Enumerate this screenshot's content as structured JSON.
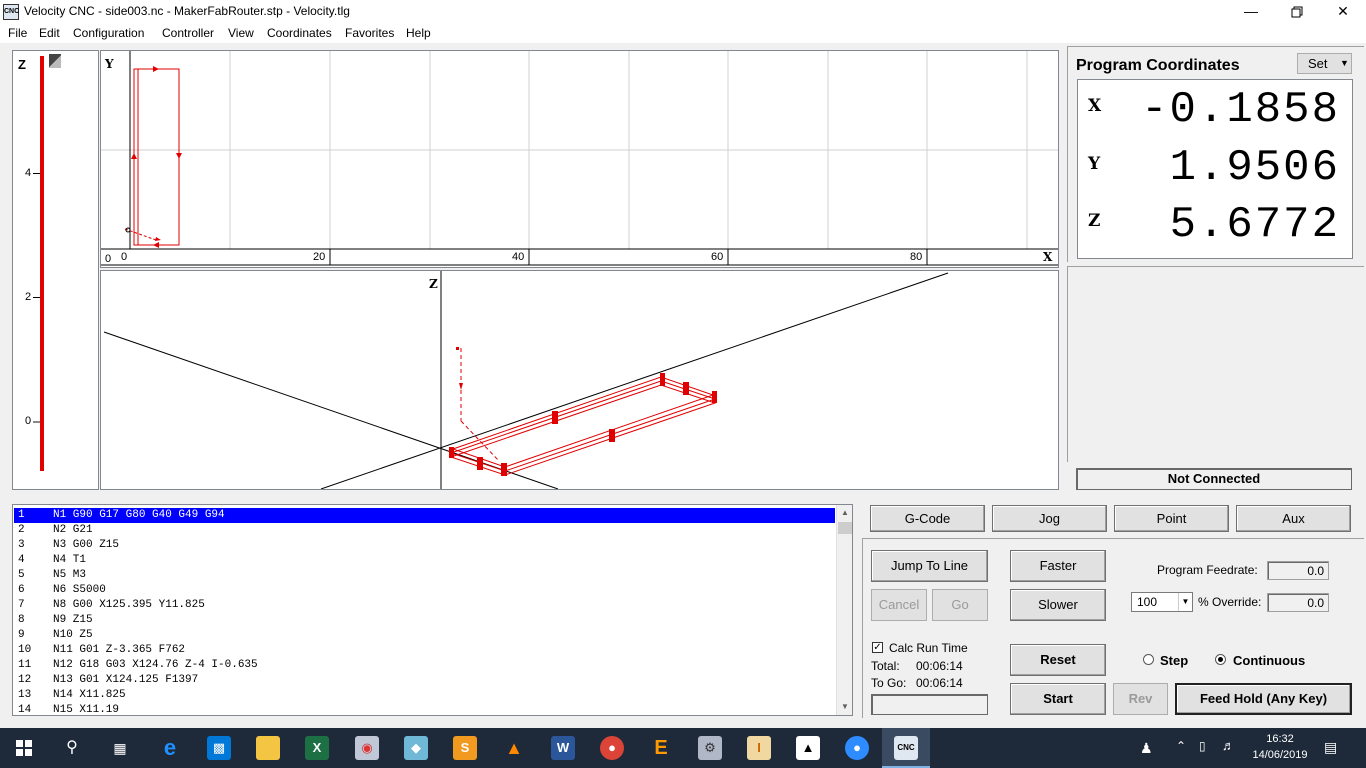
{
  "window": {
    "title": "Velocity CNC - side003.nc - MakerFabRouter.stp - Velocity.tlg",
    "app_icon_text": "CNC"
  },
  "menu": [
    "File",
    "Edit",
    "Configuration",
    "Controller",
    "View",
    "Coordinates",
    "Favorites",
    "Help"
  ],
  "z_scale": {
    "axis_label": "Z",
    "ticks": [
      "4",
      "2",
      "0"
    ]
  },
  "xy_view": {
    "y_label": "Y",
    "x_label": "X",
    "y_zero": "0",
    "x_ticks": [
      "0",
      "20",
      "40",
      "60",
      "80"
    ]
  },
  "iso_view": {
    "z_label": "Z"
  },
  "coordinates": {
    "title": "Program Coordinates",
    "set_label": "Set",
    "x_label": "X",
    "x_value": "-0.1858",
    "y_label": "Y",
    "y_value": "1.9506",
    "z_label": "Z",
    "z_value": "5.6772"
  },
  "status": {
    "connection": "Not Connected"
  },
  "code": [
    {
      "n": "1",
      "t": "N1 G90 G17 G80 G40 G49 G94"
    },
    {
      "n": "2",
      "t": "N2 G21"
    },
    {
      "n": "3",
      "t": "N3 G00 Z15"
    },
    {
      "n": "4",
      "t": "N4 T1"
    },
    {
      "n": "5",
      "t": "N5 M3"
    },
    {
      "n": "6",
      "t": "N6 S5000"
    },
    {
      "n": "7",
      "t": "N8 G00 X125.395 Y11.825"
    },
    {
      "n": "8",
      "t": "N9 Z15"
    },
    {
      "n": "9",
      "t": "N10 Z5"
    },
    {
      "n": "10",
      "t": "N11 G01 Z-3.365 F762"
    },
    {
      "n": "11",
      "t": "N12 G18 G03 X124.76 Z-4 I-0.635"
    },
    {
      "n": "12",
      "t": "N13 G01 X124.125 F1397"
    },
    {
      "n": "13",
      "t": "N14 X11.825"
    },
    {
      "n": "14",
      "t": "N15 X11.19"
    }
  ],
  "tabs": [
    "G-Code",
    "Jog",
    "Point",
    "Aux"
  ],
  "controls": {
    "jump_to_line": "Jump To Line",
    "cancel": "Cancel",
    "go": "Go",
    "faster": "Faster",
    "slower": "Slower",
    "program_feedrate_label": "Program Feedrate:",
    "program_feedrate_value": "0.0",
    "override_select": "100",
    "override_label": "% Override:",
    "override_value": "0.0",
    "calc_run_time": "Calc Run Time",
    "calc_checked": true,
    "total_label": "Total:",
    "total_value": "00:06:14",
    "to_go_label": "To Go:",
    "to_go_value": "00:06:14",
    "reset": "Reset",
    "step": "Step",
    "continuous": "Continuous",
    "start": "Start",
    "rev": "Rev",
    "feed_hold": "Feed Hold (Any Key)"
  },
  "taskbar": {
    "time": "16:32",
    "date": "14/06/2019",
    "icons": [
      "start-icon",
      "search-icon",
      "task-view-icon",
      "edge-icon",
      "store-icon",
      "file-explorer-icon",
      "excel-icon",
      "paint-icon",
      "app-icon",
      "sublime-icon",
      "vlc-icon",
      "word-icon",
      "chrome-icon",
      "estlcam-icon",
      "sketchup-icon",
      "inkscape-icon",
      "photos-icon",
      "zoom-icon",
      "velocity-cnc-icon"
    ]
  },
  "colors": {
    "toolpath": "#e00000",
    "selection": "#0000ff",
    "taskbar": "#1e2a3a"
  }
}
